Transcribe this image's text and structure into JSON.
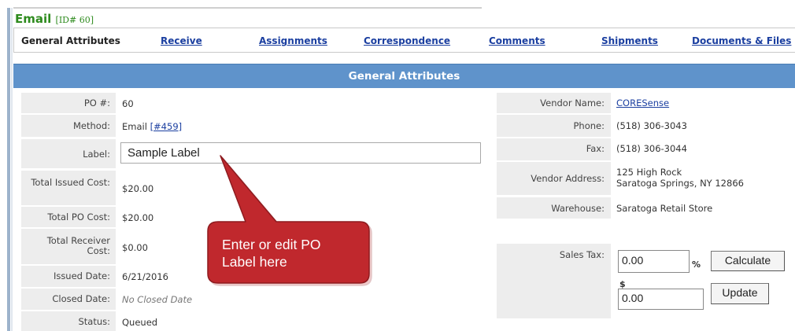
{
  "header": {
    "title": "Email",
    "id_label": "[ID# 60]"
  },
  "tabs": [
    {
      "label": "General Attributes",
      "active": true
    },
    {
      "label": "Receive"
    },
    {
      "label": "Assignments"
    },
    {
      "label": "Correspondence"
    },
    {
      "label": "Comments"
    },
    {
      "label": "Shipments"
    },
    {
      "label": "Documents & Files"
    }
  ],
  "section_title": "General Attributes",
  "left": {
    "po_label": "PO #:",
    "po_value": "60",
    "method_label": "Method:",
    "method_value": "Email",
    "method_link": "[#459]",
    "label_label": "Label:",
    "label_value": "Sample Label",
    "total_issued_label": "Total Issued Cost:",
    "total_issued_value": "$20.00",
    "total_po_label": "Total PO Cost:",
    "total_po_value": "$20.00",
    "total_receiver_label": "Total Receiver Cost:",
    "total_receiver_value": "$0.00",
    "issued_date_label": "Issued Date:",
    "issued_date_value": "6/21/2016",
    "closed_date_label": "Closed Date:",
    "closed_date_value": "No Closed Date",
    "status_label": "Status:",
    "status_value": "Queued"
  },
  "right": {
    "vendor_name_label": "Vendor Name:",
    "vendor_name_value": "CORESense",
    "phone_label": "Phone:",
    "phone_value": "(518) 306-3043",
    "fax_label": "Fax:",
    "fax_value": "(518) 306-3044",
    "vendor_address_label": "Vendor Address:",
    "vendor_address_line1": "125 High Rock",
    "vendor_address_line2": "Saratoga Springs, NY 12866",
    "warehouse_label": "Warehouse:",
    "warehouse_value": "Saratoga Retail Store",
    "sales_tax_label": "Sales Tax:",
    "sales_tax_percent_value": "0.00",
    "percent_sign": "%",
    "calculate_label": "Calculate",
    "dollar_sign": "$",
    "sales_tax_amount_value": "0.00",
    "update_label": "Update"
  },
  "callout": {
    "text": "Enter or edit PO Label here"
  },
  "colors": {
    "title_green": "#2e8b1e",
    "band_blue": "#5f93cb",
    "link_blue": "#1b3fa0",
    "callout_red": "#c0282d"
  }
}
